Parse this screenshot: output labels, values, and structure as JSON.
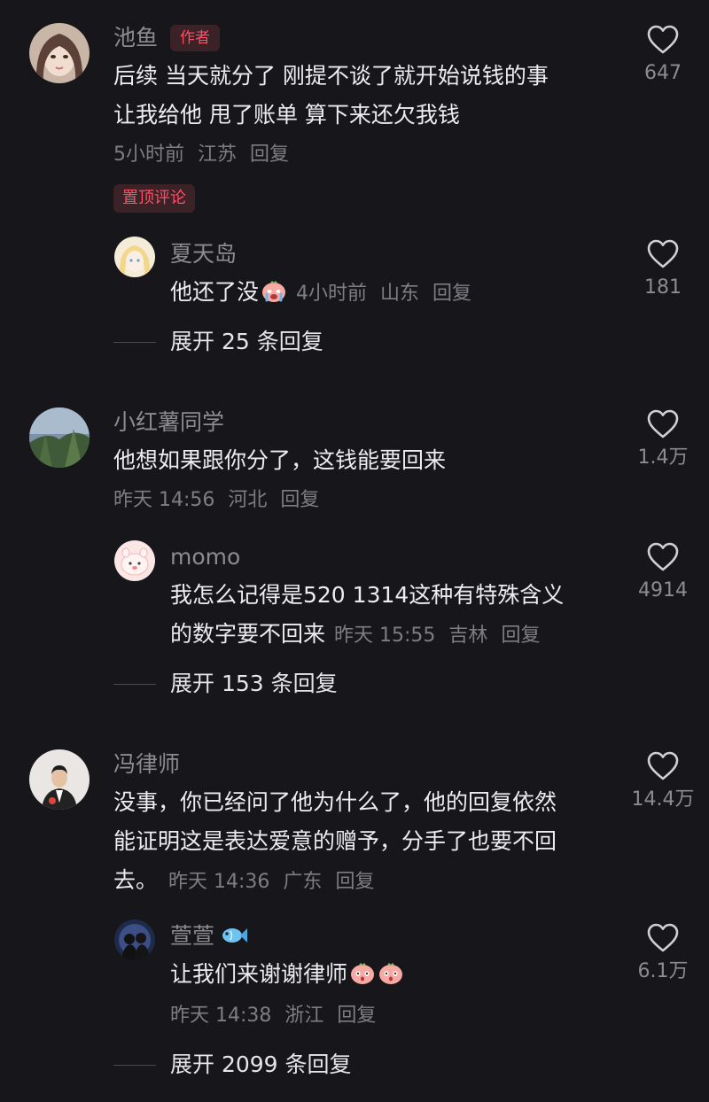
{
  "comments": [
    {
      "username": "池鱼",
      "author_badge": "作者",
      "lines": [
        "后续 当天就分了 刚提不谈了就开始说钱的事",
        "让我给他 甩了账单 算下来还欠我钱"
      ],
      "time": "5小时前",
      "location": "江苏",
      "reply_label": "回复",
      "likes": "647",
      "pinned_label": "置顶评论",
      "replies": [
        {
          "username": "夏天岛",
          "text": "他还了没",
          "time": "4小时前",
          "location": "山东",
          "reply_label": "回复",
          "likes": "181"
        }
      ],
      "expand_label": "展开 25 条回复"
    },
    {
      "username": "小红薯同学",
      "lines": [
        "他想如果跟你分了，这钱能要回来"
      ],
      "time": "昨天 14:56",
      "location": "河北",
      "reply_label": "回复",
      "likes": "1.4万",
      "replies": [
        {
          "username": "momo",
          "lines": [
            "我怎么记得是520 1314这种有特殊含义",
            "的数字要不回来"
          ],
          "time": "昨天 15:55",
          "location": "吉林",
          "reply_label": "回复",
          "likes": "4914"
        }
      ],
      "expand_label": "展开 153 条回复"
    },
    {
      "username": "冯律师",
      "lines": [
        "没事，你已经问了他为什么了，他的回复依然",
        "能证明这是表达爱意的赠予，分手了也要不回",
        "去。"
      ],
      "time": "昨天 14:36",
      "location": "广东",
      "reply_label": "回复",
      "likes": "14.4万",
      "replies": [
        {
          "username": "萱萱",
          "text": "让我们来谢谢律师",
          "time": "昨天 14:38",
          "location": "浙江",
          "reply_label": "回复",
          "likes": "6.1万"
        }
      ],
      "expand_label": "展开 2099 条回复"
    }
  ],
  "colors": {
    "background": "#16161b",
    "accent": "#ff4f66",
    "muted": "#7d7d84",
    "text": "#ededef"
  },
  "icons": [
    "heart-outline-icon",
    "crying-emoji-icon",
    "peach-emoji-icon",
    "fish-icon"
  ]
}
